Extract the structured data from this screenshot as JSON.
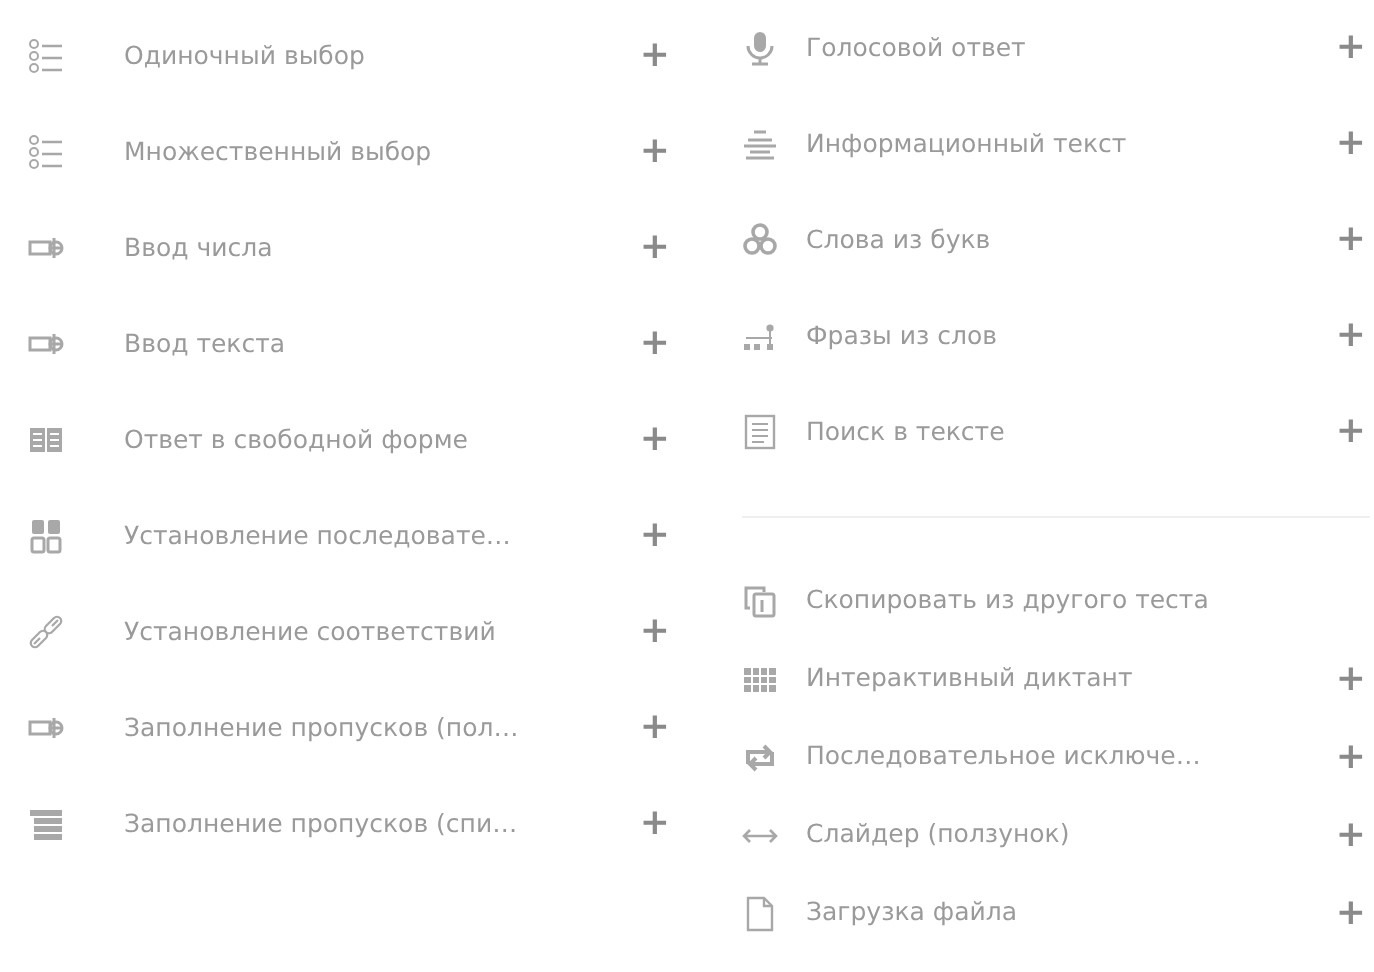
{
  "left": [
    {
      "kind": "radio-list",
      "label": "Одиночный выбор",
      "add": "+"
    },
    {
      "kind": "radio-list",
      "label": "Множественный выбор",
      "add": "+"
    },
    {
      "kind": "input",
      "label": "Ввод числа",
      "add": "+"
    },
    {
      "kind": "input",
      "label": "Ввод текста",
      "add": "+"
    },
    {
      "kind": "book",
      "label": "Ответ в свободной форме",
      "add": "+"
    },
    {
      "kind": "grid",
      "label": "Установление последовате…",
      "add": "+"
    },
    {
      "kind": "link",
      "label": "Установление соответствий",
      "add": "+"
    },
    {
      "kind": "input",
      "label": "Заполнение пропусков (пол…",
      "add": "+"
    },
    {
      "kind": "stack",
      "label": "Заполнение пропусков (спи…",
      "add": "+"
    }
  ],
  "right_top": [
    {
      "kind": "mic",
      "label": "Голосовой ответ",
      "add": "+"
    },
    {
      "kind": "lines",
      "label": "Информационный текст",
      "add": "+"
    },
    {
      "kind": "circles",
      "label": "Слова из букв",
      "add": "+"
    },
    {
      "kind": "dots",
      "label": "Фразы из слов",
      "add": "+"
    },
    {
      "kind": "doc",
      "label": "Поиск в тексте",
      "add": "+"
    }
  ],
  "right_bottom": [
    {
      "kind": "copy",
      "label": "Скопировать из другого теста"
    },
    {
      "kind": "table",
      "label": "Интерактивный диктант",
      "add": "+"
    },
    {
      "kind": "swap",
      "label": "Последовательное исключе…",
      "add": "+"
    },
    {
      "kind": "arrows",
      "label": "Слайдер (ползунок)",
      "add": "+"
    },
    {
      "kind": "file",
      "label": "Загрузка файла",
      "add": "+"
    }
  ]
}
